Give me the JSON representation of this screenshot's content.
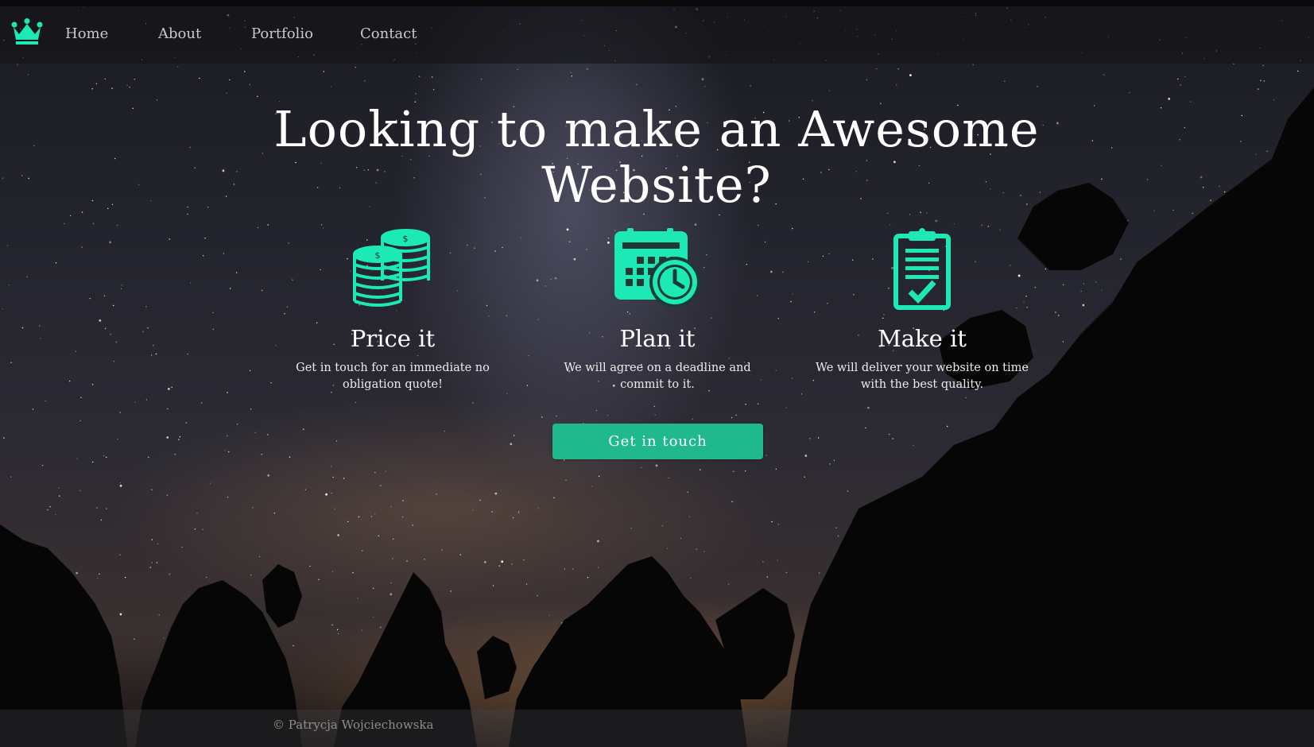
{
  "nav": {
    "logo_icon": "crown-icon",
    "items": [
      {
        "label": "Home"
      },
      {
        "label": "About"
      },
      {
        "label": "Portfolio"
      },
      {
        "label": "Contact"
      }
    ]
  },
  "hero": {
    "title_line1": "Looking to make an Awesome",
    "title_line2": "Website?"
  },
  "features": [
    {
      "icon": "coins-icon",
      "title": "Price it",
      "text": "Get in touch for an immediate no obligation quote!"
    },
    {
      "icon": "calendar-clock-icon",
      "title": "Plan it",
      "text": "We will agree on a deadline and commit to it."
    },
    {
      "icon": "clipboard-check-icon",
      "title": "Make it",
      "text": "We will deliver your website on time with the best quality."
    }
  ],
  "cta": {
    "label": "Get in touch"
  },
  "footer": {
    "text": "© Patrycja Wojciechowska"
  },
  "colors": {
    "accent": "#1de9b6",
    "button": "#1fb98d"
  }
}
